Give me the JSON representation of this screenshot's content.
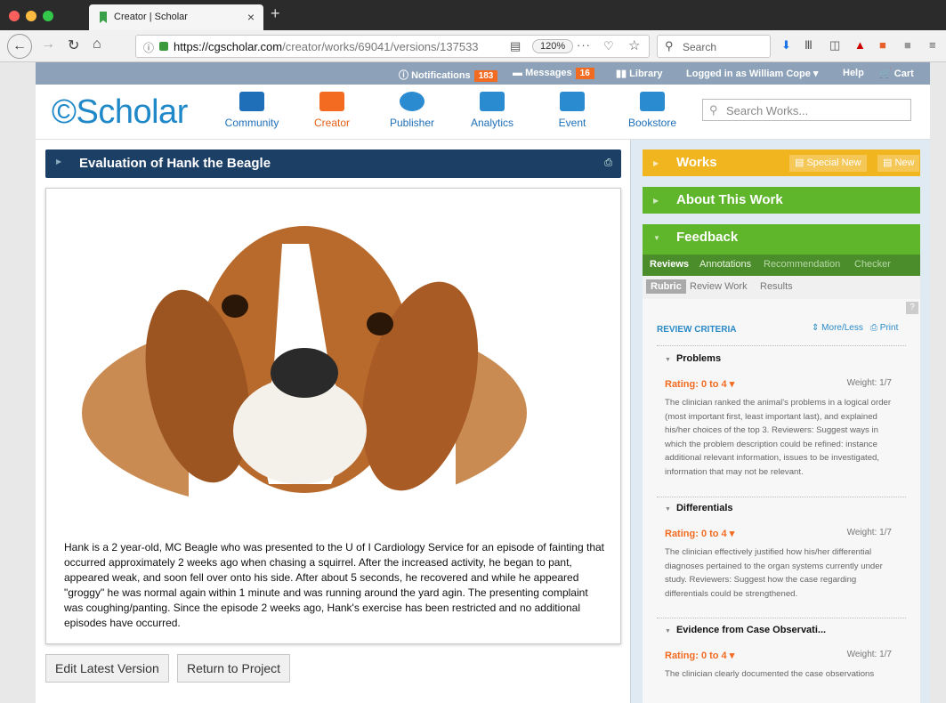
{
  "browser": {
    "tab_title": "Creator | Scholar",
    "tab_close": "×",
    "new_tab": "+",
    "url_host": "https://cgscholar.com",
    "url_path": "/creator/works/69041/versions/137533",
    "zoom": "120%",
    "search_placeholder": "Search",
    "more": "···"
  },
  "topbar": {
    "notifications_label": "Notifications",
    "notifications_count": "183",
    "messages_label": "Messages",
    "messages_count": "16",
    "library_label": "Library",
    "user_label": "Logged in as William Cope",
    "help_label": "Help",
    "cart_label": "Cart"
  },
  "header": {
    "logo": "Scholar",
    "nav": [
      "Community",
      "Creator",
      "Publisher",
      "Analytics",
      "Event",
      "Bookstore"
    ],
    "search_placeholder": "Search Works..."
  },
  "work": {
    "title": "Evaluation of Hank the Beagle",
    "body": "Hank is a 2 year-old, MC Beagle who was presented to the U of I Cardiology Service for an episode of fainting that occurred approximately 2 weeks ago when chasing a squirrel. After the increased activity, he began to pant, appeared weak, and soon fell over onto his side. After about 5 seconds, he recovered and while he appeared \"groggy\" he was normal again within 1 minute and was running around the yard agin. The presenting complaint was coughing/panting. Since the episode 2 weeks ago, Hank's exercise has been restricted and no additional episodes have occurred.",
    "edit_button": "Edit Latest Version",
    "return_button": "Return to Project"
  },
  "sidebar": {
    "works_title": "Works",
    "special_new": "Special New",
    "new": "New",
    "about_title": "About This Work",
    "feedback_title": "Feedback",
    "feedback_tabs": [
      "Reviews",
      "Annotations",
      "Recommendation",
      "Checker"
    ],
    "sub_tabs": [
      "Rubric",
      "Review Work",
      "Results"
    ],
    "review_criteria": "REVIEW CRITERIA",
    "more_less": "More/Less",
    "print": "Print",
    "help": "?",
    "criteria": [
      {
        "name": "Problems",
        "rating": "Rating: 0 to 4",
        "weight": "Weight: 1/7",
        "desc": "The clinician ranked the animal's problems in a logical order (most important first, least important last), and explained his/her choices of the top 3. Reviewers: Suggest ways in which the problem description could be refined: instance additional relevant information, issues to be investigated, information that may not be relevant."
      },
      {
        "name": "Differentials",
        "rating": "Rating: 0 to 4",
        "weight": "Weight: 1/7",
        "desc": "The clinician effectively justified how his/her differential diagnoses pertained to the organ systems currently under study. Reviewers: Suggest how the case regarding differentials could be strengthened."
      },
      {
        "name": "Evidence from Case Observati...",
        "rating": "Rating: 0 to 4",
        "weight": "Weight: 1/7",
        "desc": "The clinician clearly documented the case observations"
      }
    ]
  }
}
